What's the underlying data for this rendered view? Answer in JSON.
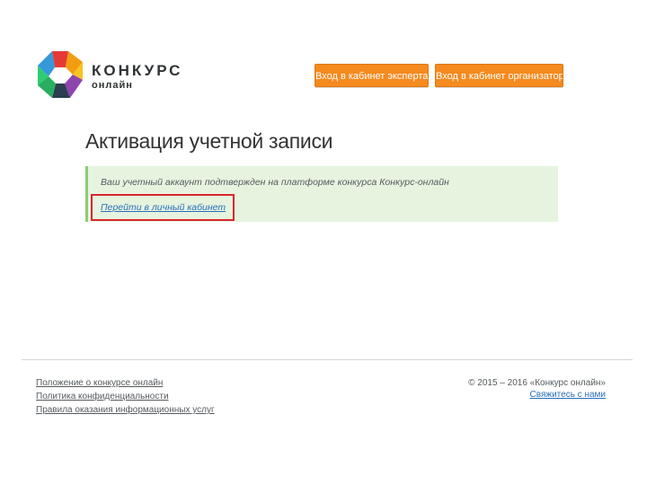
{
  "header": {
    "logo_title": "КОНКУРС",
    "logo_subtitle": "онлайн",
    "buttons": [
      {
        "label": "Вход в кабинет эксперта"
      },
      {
        "label": "Вход в кабинет организатора"
      }
    ]
  },
  "main": {
    "title": "Активация учетной записи",
    "notice": {
      "text": "Ваш учетный аккаунт подтвержден на платформе конкурса Конкурс-онлайн",
      "link": "Перейти в личный кабинет"
    }
  },
  "footer": {
    "links": [
      "Положение о конкурсе онлайн",
      "Политика конфиденциальности",
      "Правила оказания информационных услуг"
    ],
    "copyright": "© 2015 – 2016 «Конкурс онлайн»",
    "contact": "Свяжитесь с нами"
  },
  "colors": {
    "accent": "#f58a1f",
    "notice_bg": "#e6f4df",
    "notice_border": "#8ccc73",
    "link": "#2a6ebb",
    "highlight": "#d9262c"
  },
  "icons": [
    "logo-flower-icon"
  ]
}
